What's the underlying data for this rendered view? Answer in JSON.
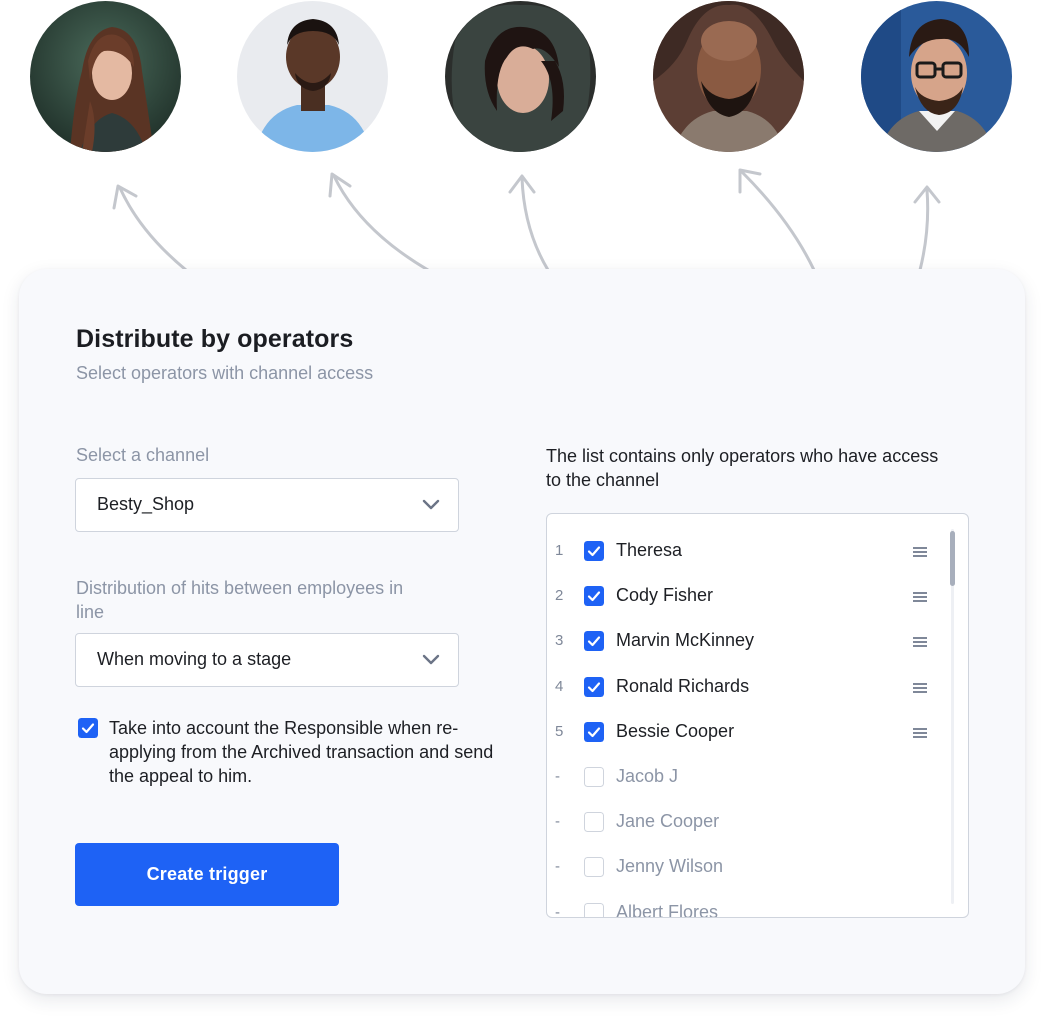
{
  "avatars": [
    {
      "icon": "operator-photo-woman-long-hair"
    },
    {
      "icon": "operator-photo-man-blue-shirt"
    },
    {
      "icon": "operator-photo-woman-dark-hair"
    },
    {
      "icon": "operator-photo-man-bald-beard"
    },
    {
      "icon": "operator-photo-man-glasses"
    }
  ],
  "card": {
    "title": "Distribute by operators",
    "subtitle": "Select operators with channel access"
  },
  "channel": {
    "label": "Select a channel",
    "value": "Besty_Shop"
  },
  "distribution": {
    "label": "Distribution of hits between employees in line",
    "value": "When moving to a stage"
  },
  "responsible": {
    "checked": true,
    "text": "Take into account the Responsible when re-applying from the Archived transaction and send the appeal to him."
  },
  "create_button": {
    "label": "Create trigger"
  },
  "operators_list": {
    "note": "The list contains only operators who have access to the channel",
    "items": [
      {
        "index": "1",
        "name": "Theresa",
        "checked": true
      },
      {
        "index": "2",
        "name": "Cody Fisher",
        "checked": true
      },
      {
        "index": "3",
        "name": "Marvin McKinney",
        "checked": true
      },
      {
        "index": "4",
        "name": "Ronald Richards",
        "checked": true
      },
      {
        "index": "5",
        "name": "Bessie Cooper",
        "checked": true
      },
      {
        "index": "-",
        "name": "Jacob J",
        "checked": false
      },
      {
        "index": "-",
        "name": "Jane Cooper",
        "checked": false
      },
      {
        "index": "-",
        "name": "Jenny Wilson",
        "checked": false
      },
      {
        "index": "-",
        "name": "Albert Flores",
        "checked": false
      }
    ]
  },
  "colors": {
    "accent": "#1e62f5",
    "muted_text": "#8c95a6",
    "card_bg": "#f8f9fc",
    "border": "#cfd4dd"
  }
}
